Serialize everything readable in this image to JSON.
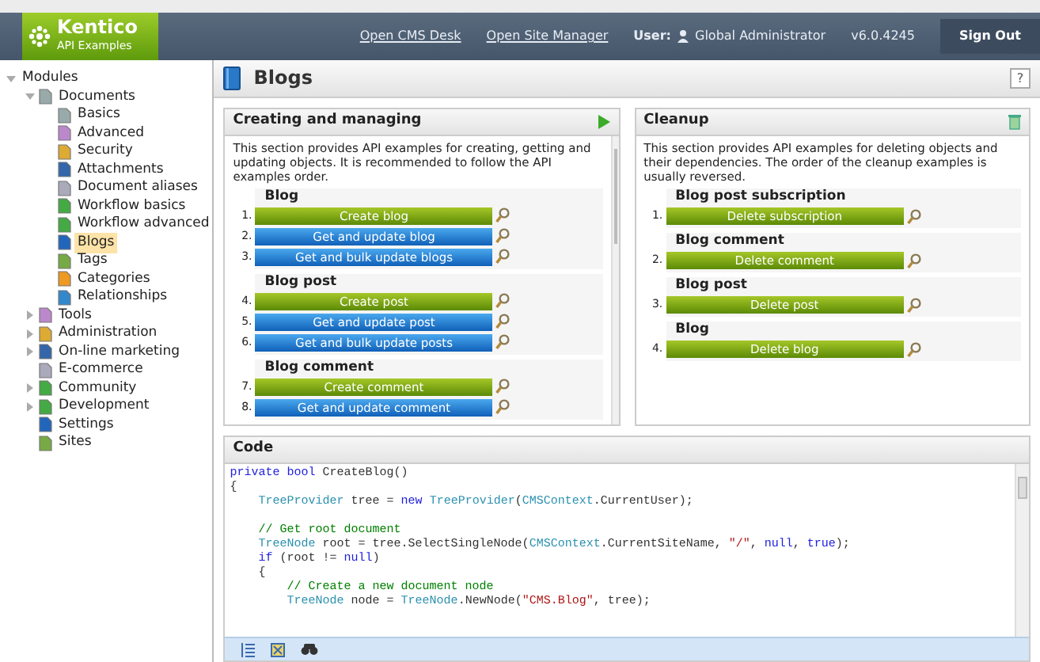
{
  "header": {
    "logo": {
      "title": "Kentico",
      "subtitle": "API Examples"
    },
    "links": [
      "Open CMS Desk",
      "Open Site Manager"
    ],
    "user_label": "User:",
    "user_name": "Global Administrator",
    "version": "v6.0.4245",
    "sign_out": "Sign Out"
  },
  "tree": [
    {
      "label": "Modules",
      "expanded": true,
      "selected": false,
      "children": [
        {
          "label": "Documents",
          "expanded": true,
          "selected": false,
          "children": [
            {
              "label": "Basics",
              "selected": false
            },
            {
              "label": "Advanced",
              "selected": false
            },
            {
              "label": "Security",
              "selected": false
            },
            {
              "label": "Attachments",
              "selected": false
            },
            {
              "label": "Document aliases",
              "selected": false
            },
            {
              "label": "Workflow basics",
              "selected": false
            },
            {
              "label": "Workflow advanced",
              "selected": false
            },
            {
              "label": "Blogs",
              "selected": true
            },
            {
              "label": "Tags",
              "selected": false
            },
            {
              "label": "Categories",
              "selected": false
            },
            {
              "label": "Relationships",
              "selected": false
            }
          ]
        },
        {
          "label": "Tools",
          "expanded": false,
          "selected": false
        },
        {
          "label": "Administration",
          "expanded": false,
          "selected": false
        },
        {
          "label": "On-line marketing",
          "expanded": false,
          "selected": false
        },
        {
          "label": "E-commerce",
          "selected": false
        },
        {
          "label": "Community",
          "expanded": false,
          "selected": false
        },
        {
          "label": "Development",
          "expanded": false,
          "selected": false
        },
        {
          "label": "Settings",
          "selected": false
        },
        {
          "label": "Sites",
          "selected": false
        }
      ]
    }
  ],
  "page_title": "Blogs",
  "help": "?",
  "panels": [
    {
      "title": "Creating and managing",
      "kind": "run",
      "description": "This section provides API examples for creating, getting and updating objects. It is recommended to follow the API examples order.",
      "groups": [
        {
          "title": "Blog",
          "items": [
            {
              "number": "1.",
              "label": "Create blog",
              "kind": "create"
            },
            {
              "number": "2.",
              "label": "Get and update blog",
              "kind": "update"
            },
            {
              "number": "3.",
              "label": "Get and bulk update blogs",
              "kind": "update"
            }
          ]
        },
        {
          "title": "Blog post",
          "items": [
            {
              "number": "4.",
              "label": "Create post",
              "kind": "create"
            },
            {
              "number": "5.",
              "label": "Get and update post",
              "kind": "update"
            },
            {
              "number": "6.",
              "label": "Get and bulk update posts",
              "kind": "update"
            }
          ]
        },
        {
          "title": "Blog comment",
          "items": [
            {
              "number": "7.",
              "label": "Create comment",
              "kind": "create"
            },
            {
              "number": "8.",
              "label": "Get and update comment",
              "kind": "update"
            }
          ]
        }
      ]
    },
    {
      "title": "Cleanup",
      "kind": "cleanup",
      "description": "This section provides API examples for deleting objects and their dependencies. The order of the cleanup examples is usually reversed.",
      "groups": [
        {
          "title": "Blog post subscription",
          "items": [
            {
              "number": "1.",
              "label": "Delete subscription",
              "kind": "create"
            }
          ]
        },
        {
          "title": "Blog comment",
          "items": [
            {
              "number": "2.",
              "label": "Delete comment",
              "kind": "create"
            }
          ]
        },
        {
          "title": "Blog post",
          "items": [
            {
              "number": "3.",
              "label": "Delete post",
              "kind": "create"
            }
          ]
        },
        {
          "title": "Blog",
          "items": [
            {
              "number": "4.",
              "label": "Delete blog",
              "kind": "create"
            }
          ]
        }
      ]
    }
  ],
  "code": {
    "title": "Code",
    "lines": [
      {
        "kind": "code",
        "tokens": [
          {
            "kind": "keyword",
            "text": "private bool"
          },
          {
            "kind": "plain",
            "text": " CreateBlog()"
          }
        ]
      },
      {
        "kind": "code",
        "tokens": [
          {
            "kind": "plain",
            "text": "{"
          }
        ]
      },
      {
        "kind": "code",
        "tokens": [
          {
            "kind": "type",
            "text": "    TreeProvider"
          },
          {
            "kind": "plain",
            "text": " tree = "
          },
          {
            "kind": "keyword",
            "text": "new"
          },
          {
            "kind": "type",
            "text": " TreeProvider"
          },
          {
            "kind": "plain",
            "text": "("
          },
          {
            "kind": "type",
            "text": "CMSContext"
          },
          {
            "kind": "plain",
            "text": ".CurrentUser);"
          }
        ]
      },
      {
        "kind": "blank"
      },
      {
        "kind": "code",
        "tokens": [
          {
            "kind": "comment",
            "text": "    // Get root document"
          }
        ]
      },
      {
        "kind": "code",
        "tokens": [
          {
            "kind": "type",
            "text": "    TreeNode"
          },
          {
            "kind": "plain",
            "text": " root = tree.SelectSingleNode("
          },
          {
            "kind": "type",
            "text": "CMSContext"
          },
          {
            "kind": "plain",
            "text": ".CurrentSiteName, "
          },
          {
            "kind": "string",
            "text": "\"/\""
          },
          {
            "kind": "plain",
            "text": ", "
          },
          {
            "kind": "keyword",
            "text": "null"
          },
          {
            "kind": "plain",
            "text": ", "
          },
          {
            "kind": "keyword",
            "text": "true"
          },
          {
            "kind": "plain",
            "text": ");"
          }
        ]
      },
      {
        "kind": "code",
        "tokens": [
          {
            "kind": "keyword",
            "text": "    if"
          },
          {
            "kind": "plain",
            "text": " (root != "
          },
          {
            "kind": "keyword",
            "text": "null"
          },
          {
            "kind": "plain",
            "text": ")"
          }
        ]
      },
      {
        "kind": "code",
        "tokens": [
          {
            "kind": "plain",
            "text": "    {"
          }
        ]
      },
      {
        "kind": "code",
        "tokens": [
          {
            "kind": "comment",
            "text": "        // Create a new document node"
          }
        ]
      },
      {
        "kind": "code",
        "tokens": [
          {
            "kind": "type",
            "text": "        TreeNode"
          },
          {
            "kind": "plain",
            "text": " node = "
          },
          {
            "kind": "type",
            "text": "TreeNode"
          },
          {
            "kind": "plain",
            "text": ".NewNode("
          },
          {
            "kind": "string",
            "text": "\"CMS.Blog\""
          },
          {
            "kind": "plain",
            "text": ", tree);"
          }
        ]
      }
    ]
  }
}
